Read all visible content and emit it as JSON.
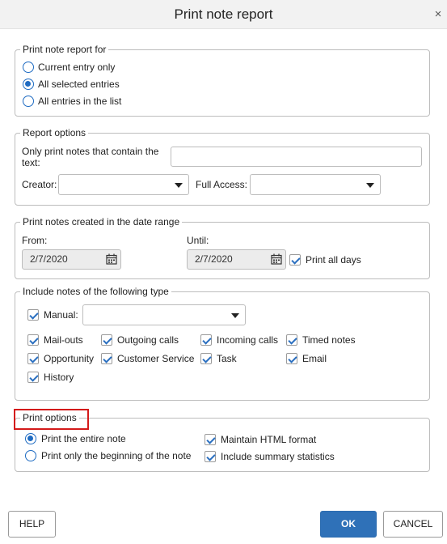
{
  "dialog": {
    "title": "Print note report",
    "close_glyph": "×"
  },
  "report_for": {
    "legend": "Print note report for",
    "options": [
      {
        "label": "Current entry only",
        "selected": false
      },
      {
        "label": "All selected entries",
        "selected": true
      },
      {
        "label": "All entries in the list",
        "selected": false
      }
    ]
  },
  "report_options": {
    "legend": "Report options",
    "contains_label_line1": "Only print notes that contain the",
    "contains_label_line2": "text:",
    "contains_value": "",
    "creator_label": "Creator:",
    "creator_value": "",
    "full_access_label": "Full Access:",
    "full_access_value": ""
  },
  "date_range": {
    "legend": "Print notes created in the date range",
    "from_label": "From:",
    "from_value": "2/7/2020",
    "until_label": "Until:",
    "until_value": "2/7/2020",
    "print_all_days_label": "Print all days",
    "print_all_days_checked": true
  },
  "note_types": {
    "legend": "Include notes of the following type",
    "manual_label": "Manual:",
    "manual_checked": true,
    "manual_value": "",
    "types": [
      {
        "label": "Mail-outs",
        "checked": true
      },
      {
        "label": "Outgoing calls",
        "checked": true
      },
      {
        "label": "Incoming calls",
        "checked": true
      },
      {
        "label": "Timed notes",
        "checked": true
      },
      {
        "label": "Opportunity",
        "checked": true
      },
      {
        "label": "Customer Service",
        "checked": true
      },
      {
        "label": "Task",
        "checked": true
      },
      {
        "label": "Email",
        "checked": true
      },
      {
        "label": "History",
        "checked": true
      }
    ]
  },
  "print_options": {
    "legend": "Print options",
    "entire_note_label": "Print the entire note",
    "entire_note_selected": true,
    "beginning_only_label": "Print only the beginning of the note",
    "beginning_only_selected": false,
    "html_format_label": "Maintain HTML format",
    "html_format_checked": true,
    "summary_stats_label": "Include summary statistics",
    "summary_stats_checked": true
  },
  "footer": {
    "help_label": "HELP",
    "ok_label": "OK",
    "cancel_label": "CANCEL"
  },
  "colors": {
    "accent": "#1e6bc2",
    "primary_button": "#2f71b8",
    "highlight": "#d41a1a"
  },
  "icons": {
    "close": "close-icon",
    "calendar": "calendar-icon",
    "dropdown": "chevron-down-icon"
  }
}
